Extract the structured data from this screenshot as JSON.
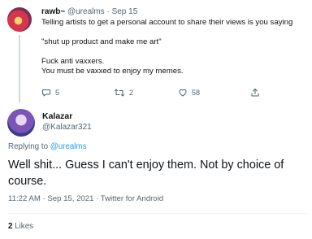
{
  "parent_tweet": {
    "display_name": "rawb~",
    "handle": "@urealms",
    "separator": " · ",
    "date": "Sep 15",
    "lines": [
      "Telling artists to get a personal account to share their views is you saying",
      "\"shut up product and make me art\"",
      "Fuck anti vaxxers.",
      "You must be vaxxed to enjoy my memes."
    ],
    "actions": {
      "reply_count": "5",
      "retweet_count": "2",
      "like_count": "58"
    }
  },
  "reply_tweet": {
    "display_name": "Kalazar",
    "handle": "@Kalazar321",
    "replying_prefix": "Replying to ",
    "replying_handle": "@urealms",
    "text": "Well shit... Guess I can't enjoy them. Not by choice of course.",
    "timestamp": "11:22 AM · Sep 15, 2021 · Twitter for Android",
    "likes_count": "2",
    "likes_label": " Likes"
  },
  "icons": {
    "reply": "speech-bubble-icon",
    "retweet": "retweet-arrows-icon",
    "like": "heart-outline-icon",
    "share": "share-upload-icon"
  },
  "colors": {
    "text_primary": "#0f1419",
    "text_secondary": "#536471",
    "link": "#1d9bf0",
    "divider": "#eff3f4"
  }
}
